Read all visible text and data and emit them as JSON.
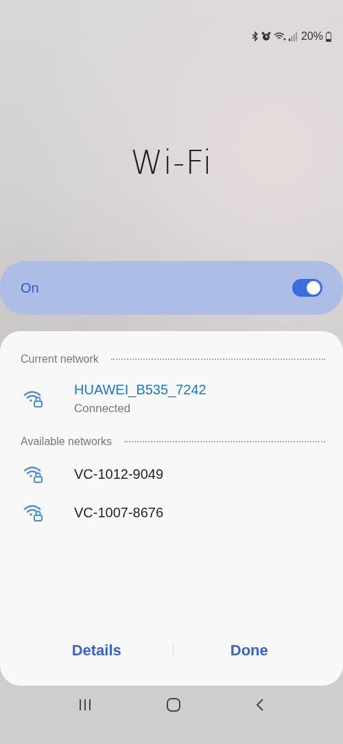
{
  "status_bar": {
    "battery": "20%"
  },
  "title": "Wi‑Fi",
  "toggle": {
    "label": "On",
    "on": true
  },
  "sections": [
    {
      "heading": "Current network",
      "networks": [
        {
          "name": "HUAWEI_B535_7242",
          "status": "Connected",
          "connected": true
        }
      ]
    },
    {
      "heading": "Available networks",
      "networks": [
        {
          "name": "VC-1012-9049",
          "connected": false
        },
        {
          "name": "VC-1007-8676",
          "connected": false
        }
      ]
    }
  ],
  "buttons": [
    "Details",
    "Done"
  ]
}
